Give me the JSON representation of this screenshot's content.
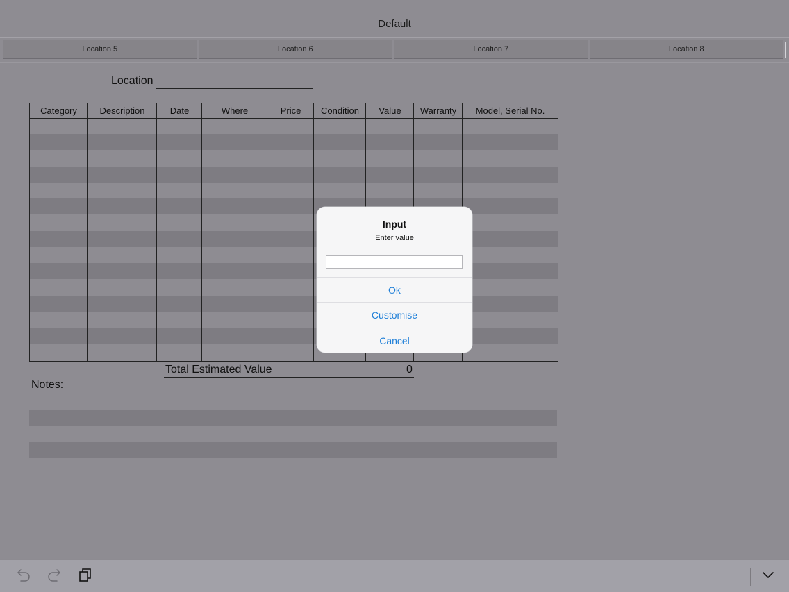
{
  "header": {
    "title": "Default"
  },
  "tabs": [
    {
      "label": "Location 5"
    },
    {
      "label": "Location 6"
    },
    {
      "label": "Location 7"
    },
    {
      "label": "Location 8"
    }
  ],
  "form": {
    "location_label": "Location",
    "location_value": "",
    "columns": [
      "Category",
      "Description",
      "Date",
      "Where",
      "Price",
      "Condition",
      "Value",
      "Warranty",
      "Model, Serial No."
    ],
    "total_label": "Total Estimated Value",
    "total_value": "0",
    "notes_label": "Notes:"
  },
  "dialog": {
    "title": "Input",
    "message": "Enter value",
    "input_value": "",
    "buttons": {
      "ok": "Ok",
      "customise": "Customise",
      "cancel": "Cancel"
    }
  },
  "toolbar": {
    "icons": [
      "undo-icon",
      "redo-icon",
      "copy-icon",
      "chevron-down-icon"
    ]
  },
  "colors": {
    "accent": "#1e7fd8",
    "overlay_bg": "#8e8c92"
  }
}
